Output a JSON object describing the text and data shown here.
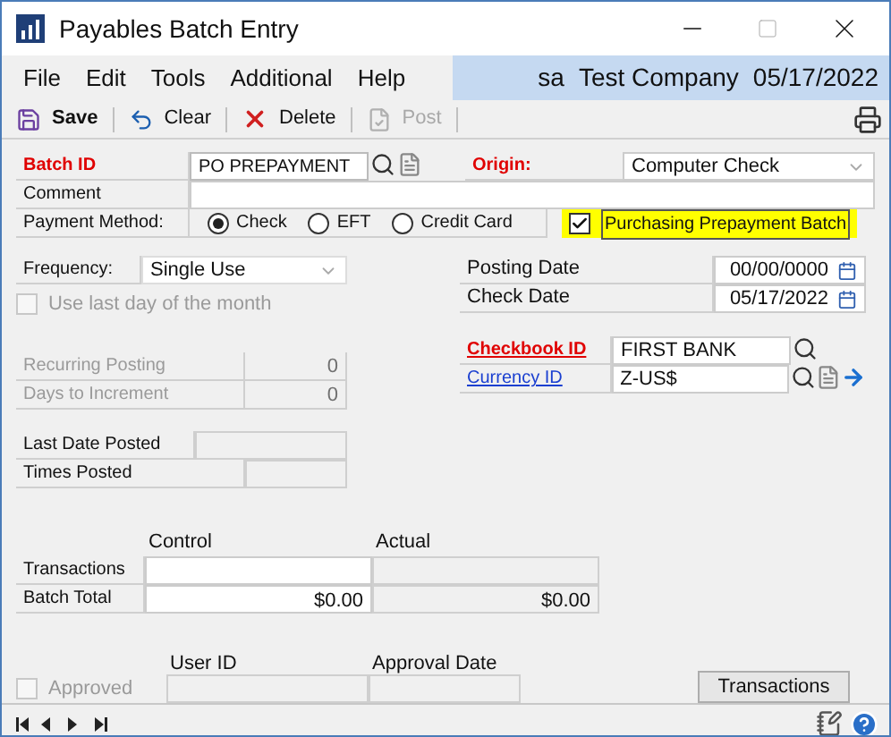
{
  "window": {
    "title": "Payables Batch Entry"
  },
  "menu": [
    "File",
    "Edit",
    "Tools",
    "Additional",
    "Help"
  ],
  "user_info": {
    "user": "sa",
    "company": "Test Company",
    "date": "05/17/2022"
  },
  "toolbar": [
    {
      "label": "Save",
      "kind": "save",
      "disabled": false
    },
    {
      "label": "Clear",
      "kind": "clear",
      "disabled": false
    },
    {
      "label": "Delete",
      "kind": "delete",
      "disabled": false
    },
    {
      "label": "Post",
      "kind": "post",
      "disabled": true
    }
  ],
  "batch_id": {
    "label": "Batch ID",
    "value": "PO PREPAYMENT"
  },
  "origin": {
    "label": "Origin:",
    "value": "Computer Check"
  },
  "comment": {
    "label": "Comment"
  },
  "payment_method": {
    "label": "Payment Method:",
    "options": [
      {
        "label": "Check",
        "selected": true
      },
      {
        "label": "EFT",
        "selected": false
      },
      {
        "label": "Credit Card",
        "selected": false
      }
    ]
  },
  "purchasing_prepayment": {
    "label": "Purchasing Prepayment Batch",
    "checked": true
  },
  "frequency": {
    "label": "Frequency:",
    "value": "Single Use"
  },
  "use_last_day": {
    "label": "Use last day of the month",
    "checked": false,
    "disabled": true
  },
  "recurring": [
    {
      "label": "Recurring Posting",
      "value": "0"
    },
    {
      "label": "Days to Increment",
      "value": "0"
    }
  ],
  "posted": [
    {
      "label": "Last Date Posted"
    },
    {
      "label": "Times Posted"
    }
  ],
  "dates": [
    {
      "label": "Posting Date",
      "value": "00/00/0000"
    },
    {
      "label": "Check Date",
      "value": "05/17/2022"
    }
  ],
  "checkbook_id": {
    "label": "Checkbook ID",
    "value": "FIRST BANK"
  },
  "currency_id": {
    "label": "Currency ID",
    "value": "Z-US$"
  },
  "totals": {
    "columns": [
      "Control",
      "Actual"
    ],
    "rows": [
      {
        "label": "Transactions"
      },
      {
        "label": "Batch Total",
        "control": "$0.00",
        "actual": "$0.00"
      }
    ]
  },
  "approval": {
    "label": "Approved",
    "checked": false,
    "disabled": true,
    "columns": [
      "User ID",
      "Approval Date"
    ]
  },
  "transactions_button": "Transactions"
}
